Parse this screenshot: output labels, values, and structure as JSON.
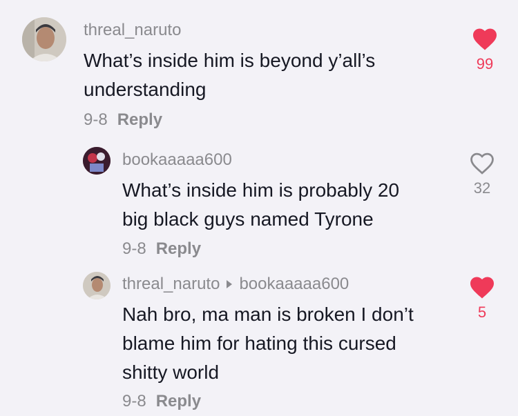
{
  "comments": [
    {
      "username": "threal_naruto",
      "text_line1": "What’s inside him is beyond y’all’s",
      "text_line2": "understanding",
      "date": "9-8",
      "reply": "Reply",
      "likes": "99",
      "liked": true,
      "icon": "heart-filled-icon"
    },
    {
      "username": "bookaaaaa600",
      "text_line1": "What’s inside him is probably 20",
      "text_line2": "big black guys named Tyrone",
      "date": "9-8",
      "reply": "Reply",
      "likes": "32",
      "liked": false,
      "icon": "heart-outline-icon"
    },
    {
      "username": "threal_naruto",
      "reply_to": "bookaaaaa600",
      "text_line1": "Nah bro, ma man is broken I don’t",
      "text_line2": "blame him for hating this cursed",
      "text_line3": "shitty world",
      "date": "9-8",
      "reply": "Reply",
      "likes": "5",
      "liked": true,
      "icon": "heart-filled-icon"
    }
  ],
  "colors": {
    "liked": "#ef3a59",
    "muted": "#8a8a8e",
    "text": "#161823",
    "background": "#f3f2f7"
  }
}
